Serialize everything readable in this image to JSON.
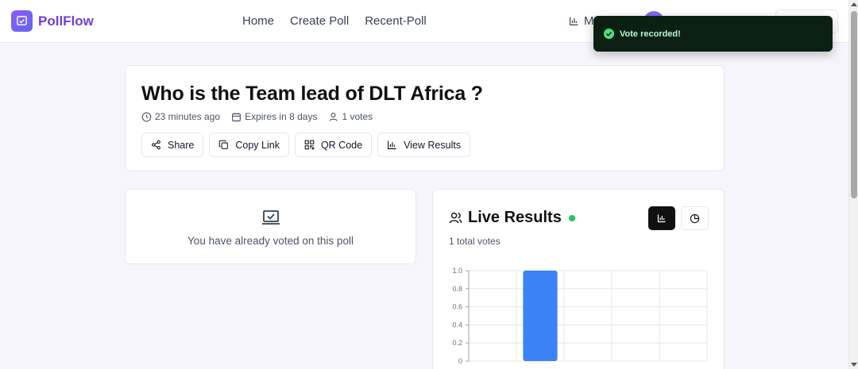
{
  "app": {
    "name": "PollFlow"
  },
  "nav": {
    "items": [
      "Home",
      "Create Poll",
      "Recent-Poll"
    ],
    "my_label": "M"
  },
  "toast": {
    "message": "Vote recorded!"
  },
  "poll": {
    "title": "Who is the Team lead of DLT Africa ?",
    "created": "23 minutes ago",
    "expires": "Expires in 8 days",
    "votes": "1 votes",
    "actions": [
      "Share",
      "Copy Link",
      "QR Code",
      "View Results"
    ]
  },
  "voted": {
    "message": "You have already voted on this poll"
  },
  "results": {
    "title": "Live Results",
    "total": "1 total votes"
  },
  "colors": {
    "brand": "#6d3fd8",
    "bar": "#3b82f6",
    "live": "#22c55e",
    "toast_bg": "#0b1f12"
  },
  "chart_data": {
    "type": "bar",
    "categories": [
      "",
      "",
      "",
      "",
      ""
    ],
    "values": [
      0,
      1,
      0,
      0,
      0
    ],
    "ylim": [
      0,
      1.0
    ],
    "yticks": [
      "0",
      "0.2",
      "0.4",
      "0.6",
      "0.8",
      "1.0"
    ],
    "grid": true
  }
}
